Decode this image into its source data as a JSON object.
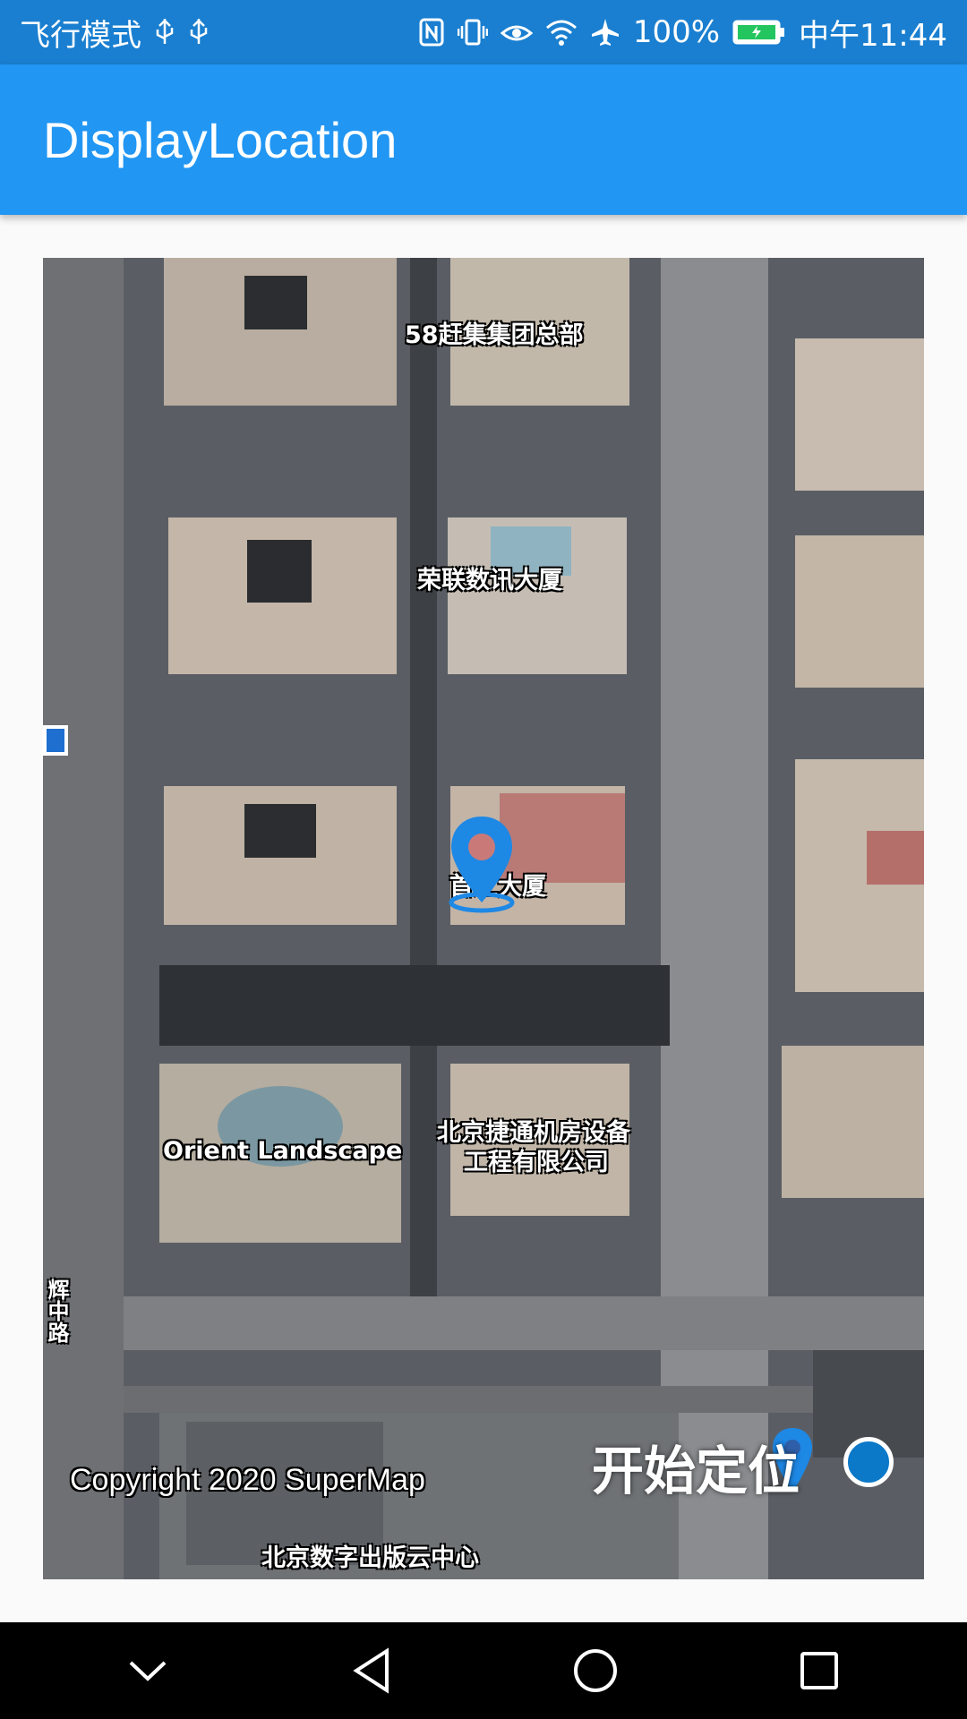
{
  "status_bar": {
    "left_text": "飞行模式",
    "left_icons": [
      "usb-icon",
      "usb-icon"
    ],
    "right_icons": [
      "nfc-icon",
      "vibrate-icon",
      "eye-icon",
      "wifi-icon",
      "airplane-icon"
    ],
    "battery_percent": "100%",
    "time": "中午11:44"
  },
  "app_bar": {
    "title": "DisplayLocation"
  },
  "map": {
    "labels": {
      "ganji": "58赶集集团总部",
      "ronglian": "荣联数讯大厦",
      "main_building": "首汇大厦",
      "jietong_line1": "北京捷通机房设备",
      "jietong_line2": "工程有限公司",
      "orient": "Orient Landscape",
      "publishing": "北京数字出版云中心",
      "side_vertical": "辉中路"
    },
    "copyright": "Copyright 2020 SuperMap",
    "start_button": "开始定位",
    "colors": {
      "marker": "#1e88e5",
      "marker_center": "#c97a78",
      "locate_dot": "#0b78c8"
    }
  },
  "nav_bar": {
    "buttons": [
      "back-chevron-icon",
      "back-triangle-icon",
      "home-circle-icon",
      "recents-square-icon"
    ]
  }
}
